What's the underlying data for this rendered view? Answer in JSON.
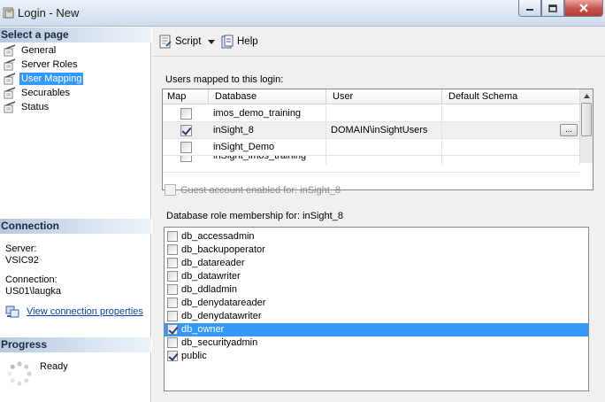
{
  "window": {
    "title": "Login - New"
  },
  "left_pane": {
    "select_page_header": "Select a page",
    "pages": [
      {
        "label": "General",
        "selected": false
      },
      {
        "label": "Server Roles",
        "selected": false
      },
      {
        "label": "User Mapping",
        "selected": true
      },
      {
        "label": "Securables",
        "selected": false
      },
      {
        "label": "Status",
        "selected": false
      }
    ],
    "connection_header": "Connection",
    "server_label": "Server:",
    "server_value": "VSIC92",
    "connection_label": "Connection:",
    "connection_value": "US01\\laugka",
    "view_connection_link": "View connection properties",
    "progress_header": "Progress",
    "progress_status": "Ready"
  },
  "toolbar": {
    "script_label": "Script",
    "help_label": "Help"
  },
  "users_mapped": {
    "label": "Users mapped to this login:",
    "columns": [
      "Map",
      "Database",
      "User",
      "Default Schema"
    ],
    "rows": [
      {
        "map": false,
        "database": "imos_demo_training",
        "user": "",
        "default_schema": "",
        "selected": false
      },
      {
        "map": true,
        "database": "inSight_8",
        "user": "DOMAIN\\inSightUsers",
        "default_schema": "",
        "selected": true
      },
      {
        "map": false,
        "database": "inSight_Demo",
        "user": "",
        "default_schema": "",
        "selected": false
      },
      {
        "map": false,
        "database": "inSight_imos_training",
        "user": "",
        "default_schema": "",
        "selected": false
      }
    ],
    "ellipsis_button": "..."
  },
  "guest_account": {
    "label": "Guest account enabled for: inSight_8",
    "checked": false,
    "enabled": false
  },
  "role_membership": {
    "label": "Database role membership for: inSight_8",
    "roles": [
      {
        "name": "db_accessadmin",
        "checked": false,
        "selected": false
      },
      {
        "name": "db_backupoperator",
        "checked": false,
        "selected": false
      },
      {
        "name": "db_datareader",
        "checked": false,
        "selected": false
      },
      {
        "name": "db_datawriter",
        "checked": false,
        "selected": false
      },
      {
        "name": "db_ddladmin",
        "checked": false,
        "selected": false
      },
      {
        "name": "db_denydatareader",
        "checked": false,
        "selected": false
      },
      {
        "name": "db_denydatawriter",
        "checked": false,
        "selected": false
      },
      {
        "name": "db_owner",
        "checked": true,
        "selected": true
      },
      {
        "name": "db_securityadmin",
        "checked": false,
        "selected": false
      },
      {
        "name": "public",
        "checked": true,
        "selected": false
      }
    ]
  },
  "colors": {
    "selection": "#3399ff",
    "link": "#0645ad",
    "close_button": "#c75050"
  }
}
